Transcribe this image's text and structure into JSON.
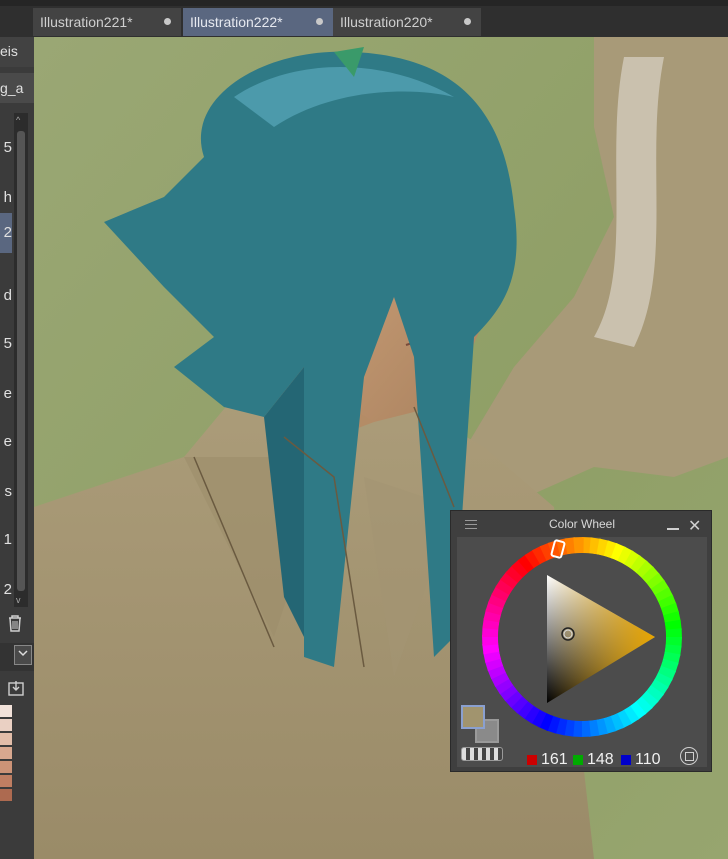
{
  "tabs": [
    {
      "label": "Illustration221*",
      "active": false
    },
    {
      "label": "Illustration222*",
      "active": true
    },
    {
      "label": "Illustration220*",
      "active": false
    }
  ],
  "left_panel": {
    "rows": [
      "eis",
      "g_a",
      "5",
      "h",
      "2",
      "d",
      "5",
      "e",
      "e",
      "s",
      "1",
      "2"
    ],
    "selected_index": 4,
    "skin_swatches": [
      "#f2e2da",
      "#ead0c3",
      "#e2bda9",
      "#d8a88f",
      "#cc9377",
      "#bf7e62",
      "#ad6a50"
    ]
  },
  "color_wheel": {
    "title": "Color Wheel",
    "rgb": {
      "r": "161",
      "g": "148",
      "b": "110"
    },
    "main_color": "#a1946e",
    "sub_color": "#8a8a8a"
  }
}
